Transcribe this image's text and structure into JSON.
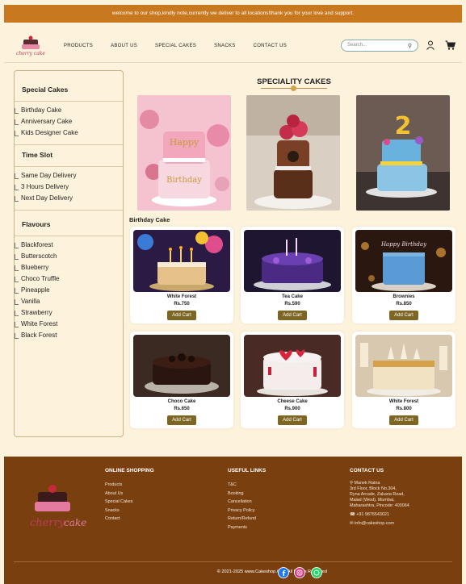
{
  "announcement": "welcome to our shop,kindly note,currently we deliver to all locations!thank you for your love and support.",
  "brand": {
    "logo_text": "cherry cake"
  },
  "nav": {
    "items": [
      "PRODUCTS",
      "ABOUT US",
      "SPECIAL CAKES",
      "SNACKS",
      "CONTACT US"
    ]
  },
  "search": {
    "placeholder": "Search..."
  },
  "icons": {
    "search": "search-icon",
    "user": "user-icon",
    "cart": "cart-icon"
  },
  "sidebar": {
    "special_cakes": {
      "title": "Special Cakes",
      "items": [
        "Birthday Cake",
        "Anniversary Cake",
        "Kids Designer Cake"
      ]
    },
    "time_slot": {
      "title": "Time Slot",
      "items": [
        "Same Day Delivery",
        "3 Hours Delivery",
        "Next Day Delivery"
      ]
    },
    "flavours": {
      "title": "Flavours",
      "items": [
        "Blackforest",
        "Butterscotch",
        "Blueberry",
        "Choco Truffle",
        "Pineapple",
        "Vanilla",
        "Strawberry",
        "White Forest",
        "Black Forest"
      ]
    }
  },
  "speciality": {
    "title": "SPECIALITY CAKES"
  },
  "birthday": {
    "label": "Birthday Cake",
    "products": [
      {
        "name": "White Forest",
        "price": "Rs.750",
        "button": "Add Cart"
      },
      {
        "name": "Tea Cake",
        "price": "Rs.590",
        "button": "Add Cart"
      },
      {
        "name": "Brownies",
        "price": "Rs.850",
        "button": "Add Cart"
      },
      {
        "name": "Choco Cake",
        "price": "Rs.650",
        "button": "Add Cart"
      },
      {
        "name": "Cheese Cake",
        "price": "Rs.900",
        "button": "Add Cart"
      },
      {
        "name": "White Forest",
        "price": "Rs.800",
        "button": "Add Cart"
      }
    ]
  },
  "footer": {
    "online_shopping": {
      "title": "ONLINE SHOPPING",
      "links": [
        "Products",
        "About Us",
        "Special Cakes",
        "Snacks",
        "Contact"
      ]
    },
    "useful_links": {
      "title": "USEFUL LINKS",
      "links": [
        "T&C",
        "Booking",
        "Cancellation",
        "Privacy Policy",
        "Return/Refund",
        "Payments"
      ]
    },
    "contact": {
      "title": "CONTACT US",
      "name": "Manek Ratna",
      "address": [
        "3rd Floor, Block No.304,",
        "Ryna Arcade, Zakaria Road,",
        "Malad (West), Mumbai,",
        "Maharashtra, Pincode: 400064"
      ],
      "phone": "+91 9876543021",
      "email": "info@cakeshop.com"
    },
    "copyright": "© 2021-2025 www.Cakeshop.Com All Rights Reserved",
    "social": [
      "facebook-icon",
      "instagram-icon",
      "whatsapp-icon"
    ]
  },
  "colors": {
    "announce": "#c8781e",
    "footer": "#7a3f0e",
    "button": "#7d6623",
    "bg": "#fdf3dc"
  }
}
